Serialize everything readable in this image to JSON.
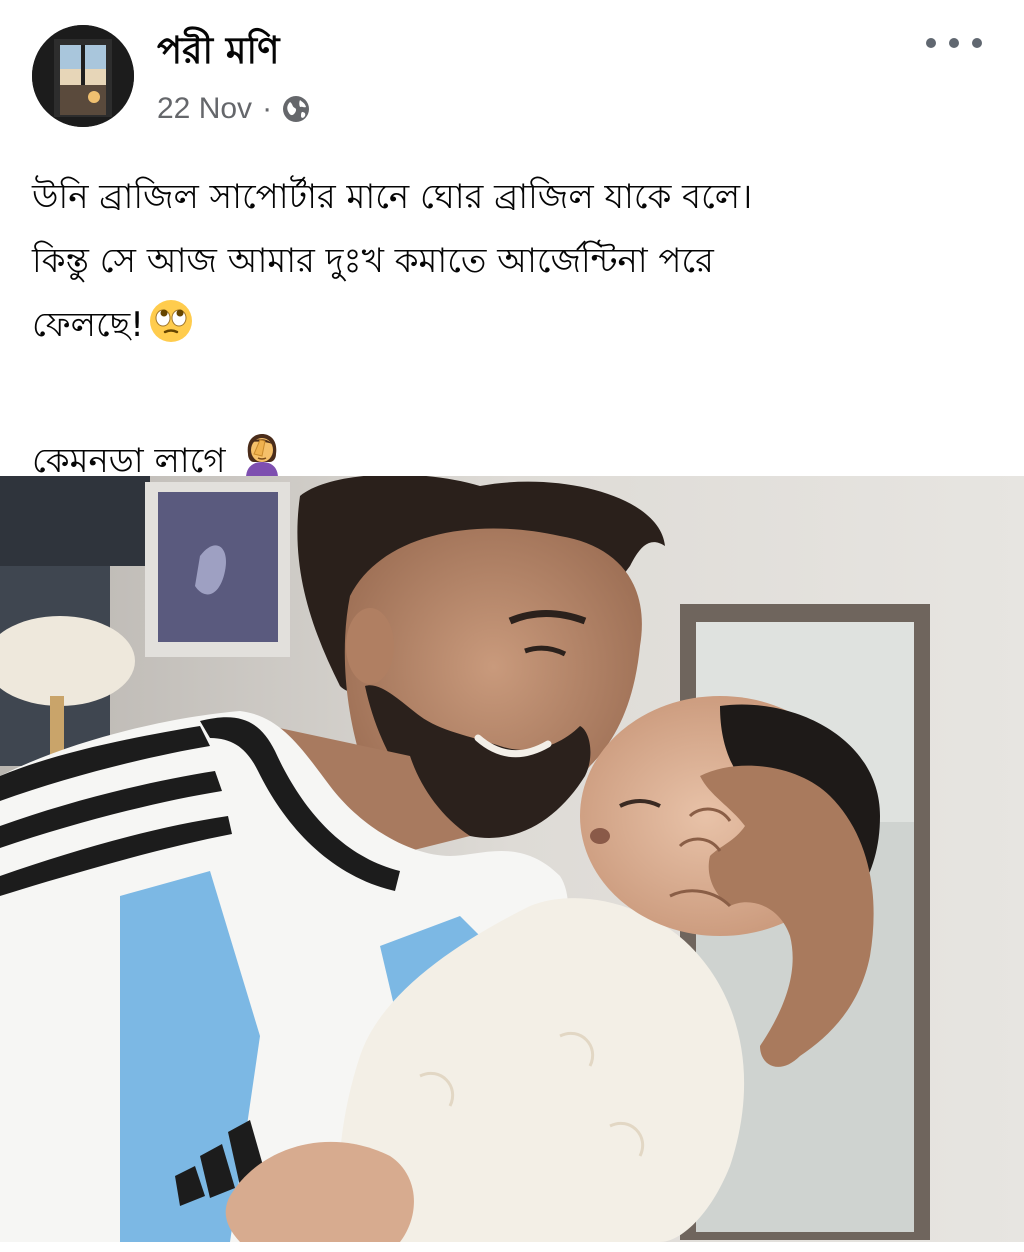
{
  "post": {
    "author": "পরী মণি",
    "date": "22 Nov",
    "separator": "·",
    "privacy_icon": "globe-icon",
    "menu_icon": "more-options-icon",
    "text": {
      "line1": "উনি ব্রাজিল সাপোর্টার মানে ঘোর ব্রাজিল যাকে বলে।",
      "line2": "কিন্তু সে আজ আমার দুঃখ কমাতে আর্জেন্টিনা পরে",
      "line3": "ফেলছে!",
      "line3_emoji": "🙄",
      "line4": "কেমনডা লাগে",
      "line4_emoji": "🤦‍♀️"
    },
    "photo_icon": "post-photo"
  },
  "colors": {
    "text": "#050505",
    "secondary": "#65676b",
    "jersey_blue": "#7cb8e4"
  }
}
